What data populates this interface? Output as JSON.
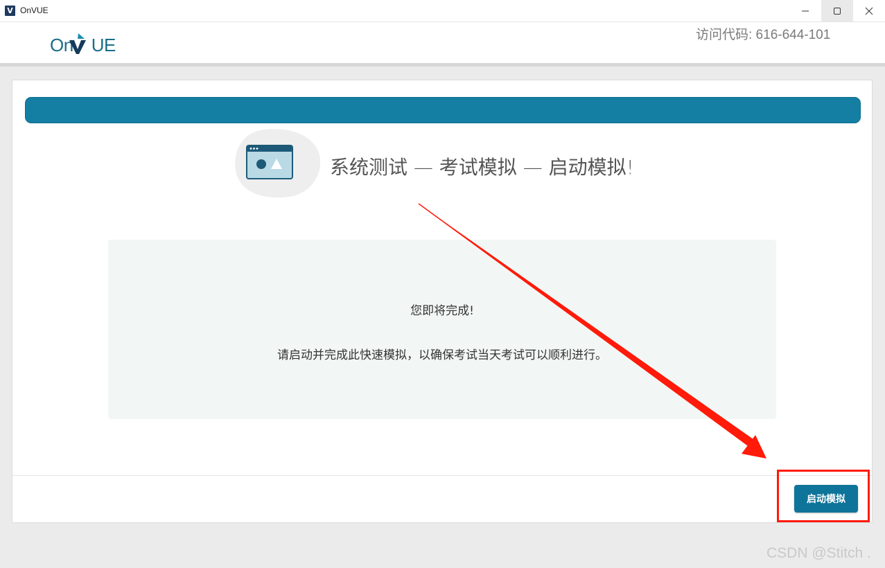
{
  "window": {
    "app_icon_letter": "V",
    "title": "OnVUE",
    "controls": [
      "minimize-icon",
      "maximize-icon",
      "close-icon"
    ]
  },
  "header": {
    "logo": {
      "prefix": "On",
      "suffix": "UE",
      "mark": "V"
    },
    "access_code": "访问代码: 616-644-101"
  },
  "main": {
    "progress_color": "#147fa3",
    "hero_icon": "browser-window-image-icon",
    "title": "系统测试 — 考试模拟 — 启动模拟!",
    "info": {
      "heading": "您即将完成!",
      "body": "请启动并完成此快速模拟，以确保考试当天考试可以顺利进行。"
    },
    "start_button_label": "启动模拟"
  },
  "annotation": {
    "color": "#ff1a0a"
  },
  "watermark": "CSDN @Stitch ."
}
